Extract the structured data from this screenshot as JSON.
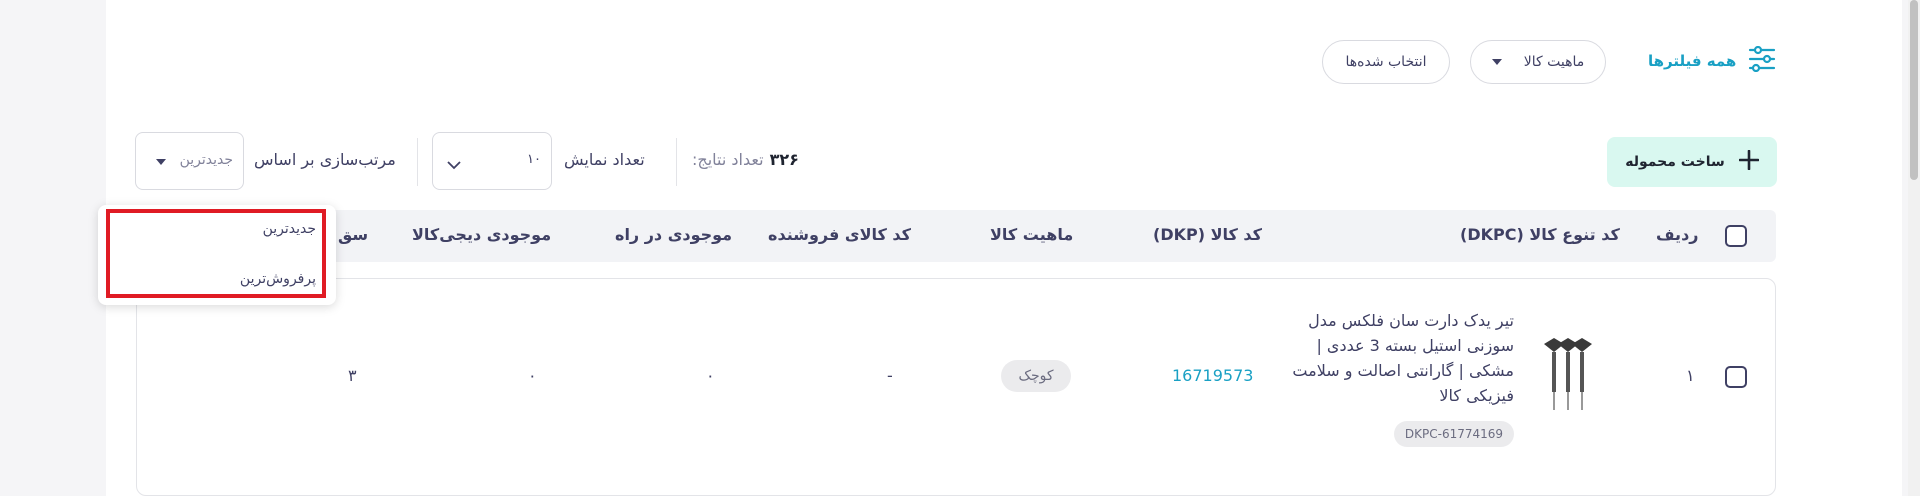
{
  "filters": {
    "all_filters_label": "همه فیلترها",
    "nature_filter_label": "ماهیت کالا",
    "selected_label": "انتخاب شده‌ها"
  },
  "toolbar": {
    "create_shipment_label": "ساخت محموله",
    "results_label": "تعداد نتایج:",
    "results_count": "۳۲۶",
    "display_count_label": "تعداد نمایش",
    "display_count_value": "۱۰",
    "sort_label": "مرتب‌سازی بر اساس",
    "sort_value": "جدیدترین"
  },
  "sort_dropdown": {
    "options": [
      "جدیدترین",
      "پرفروش‌ترین"
    ]
  },
  "table": {
    "headers": {
      "row_number": "ردیف",
      "dkpc": "کد تنوع کالا (DKPC)",
      "dkp": "کد کالا (DKP)",
      "nature": "ماهیت کالا",
      "seller_code": "کد کالای فروشنده",
      "in_transit": "موجودی در راه",
      "digikala_stock": "موجودی دیجی‌کالا",
      "truncated": "سق"
    },
    "rows": [
      {
        "row_number": "۱",
        "title": "تیر یدک دارت سان فلکس مدل سوزنی استیل بسته 3 عددی | مشکی | گارانتی اصالت و سلامت فیزیکی کالا",
        "dkpc": "DKPC-61774169",
        "dkp": "16719573",
        "nature": "کوچک",
        "seller_code": "-",
        "in_transit": "۰",
        "digikala_stock": "۰",
        "truncated_value": "۳"
      }
    ]
  },
  "colors": {
    "accent": "#19a0c4",
    "create_button_bg": "#d9f8f0",
    "highlight": "#e01b24",
    "header_bg": "#f2f3f6"
  }
}
